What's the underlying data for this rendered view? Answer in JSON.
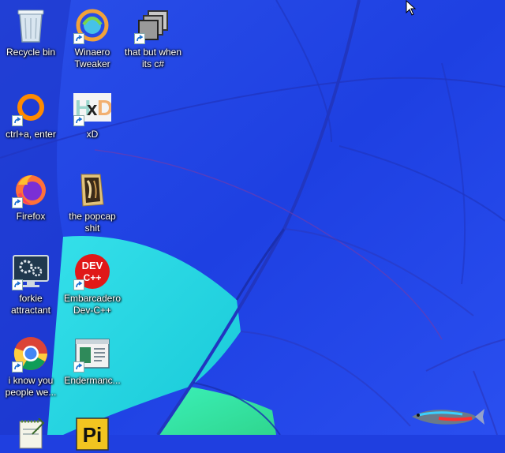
{
  "desktop": {
    "icons": [
      {
        "label": "Recycle bin",
        "icon": "recycle-bin-icon"
      },
      {
        "label": "Winaero\nTweaker",
        "icon": "winaero-tweaker-icon"
      },
      {
        "label": "that but when\nits c#",
        "icon": "stacked-windows-icon"
      },
      {
        "label": "ctrl+a, enter",
        "icon": "orange-ring-icon"
      },
      {
        "label": "xD",
        "icon": "hxd-icon"
      },
      {
        "label": "Firefox",
        "icon": "firefox-icon"
      },
      {
        "label": "the popcap\nshit",
        "icon": "folder-icon"
      },
      {
        "label": "forkie\nattractant",
        "icon": "settings-monitor-icon"
      },
      {
        "label": "Embarcadero\nDev-C++",
        "icon": "devcpp-icon"
      },
      {
        "label": "i know you\npeople we...",
        "icon": "chrome-icon"
      },
      {
        "label": "Endermanc...",
        "icon": "window-app-icon"
      },
      {
        "label": "",
        "icon": "notepad-icon"
      },
      {
        "label": "",
        "icon": "pi-icon"
      }
    ],
    "devcpp_text": "DEV\nC++",
    "hxd_text": "HxD",
    "pi_text": "Pi"
  },
  "colors": {
    "sky_blue": "#2547e6",
    "cyan": "#20d6e0",
    "green": "#3ee6a0"
  }
}
